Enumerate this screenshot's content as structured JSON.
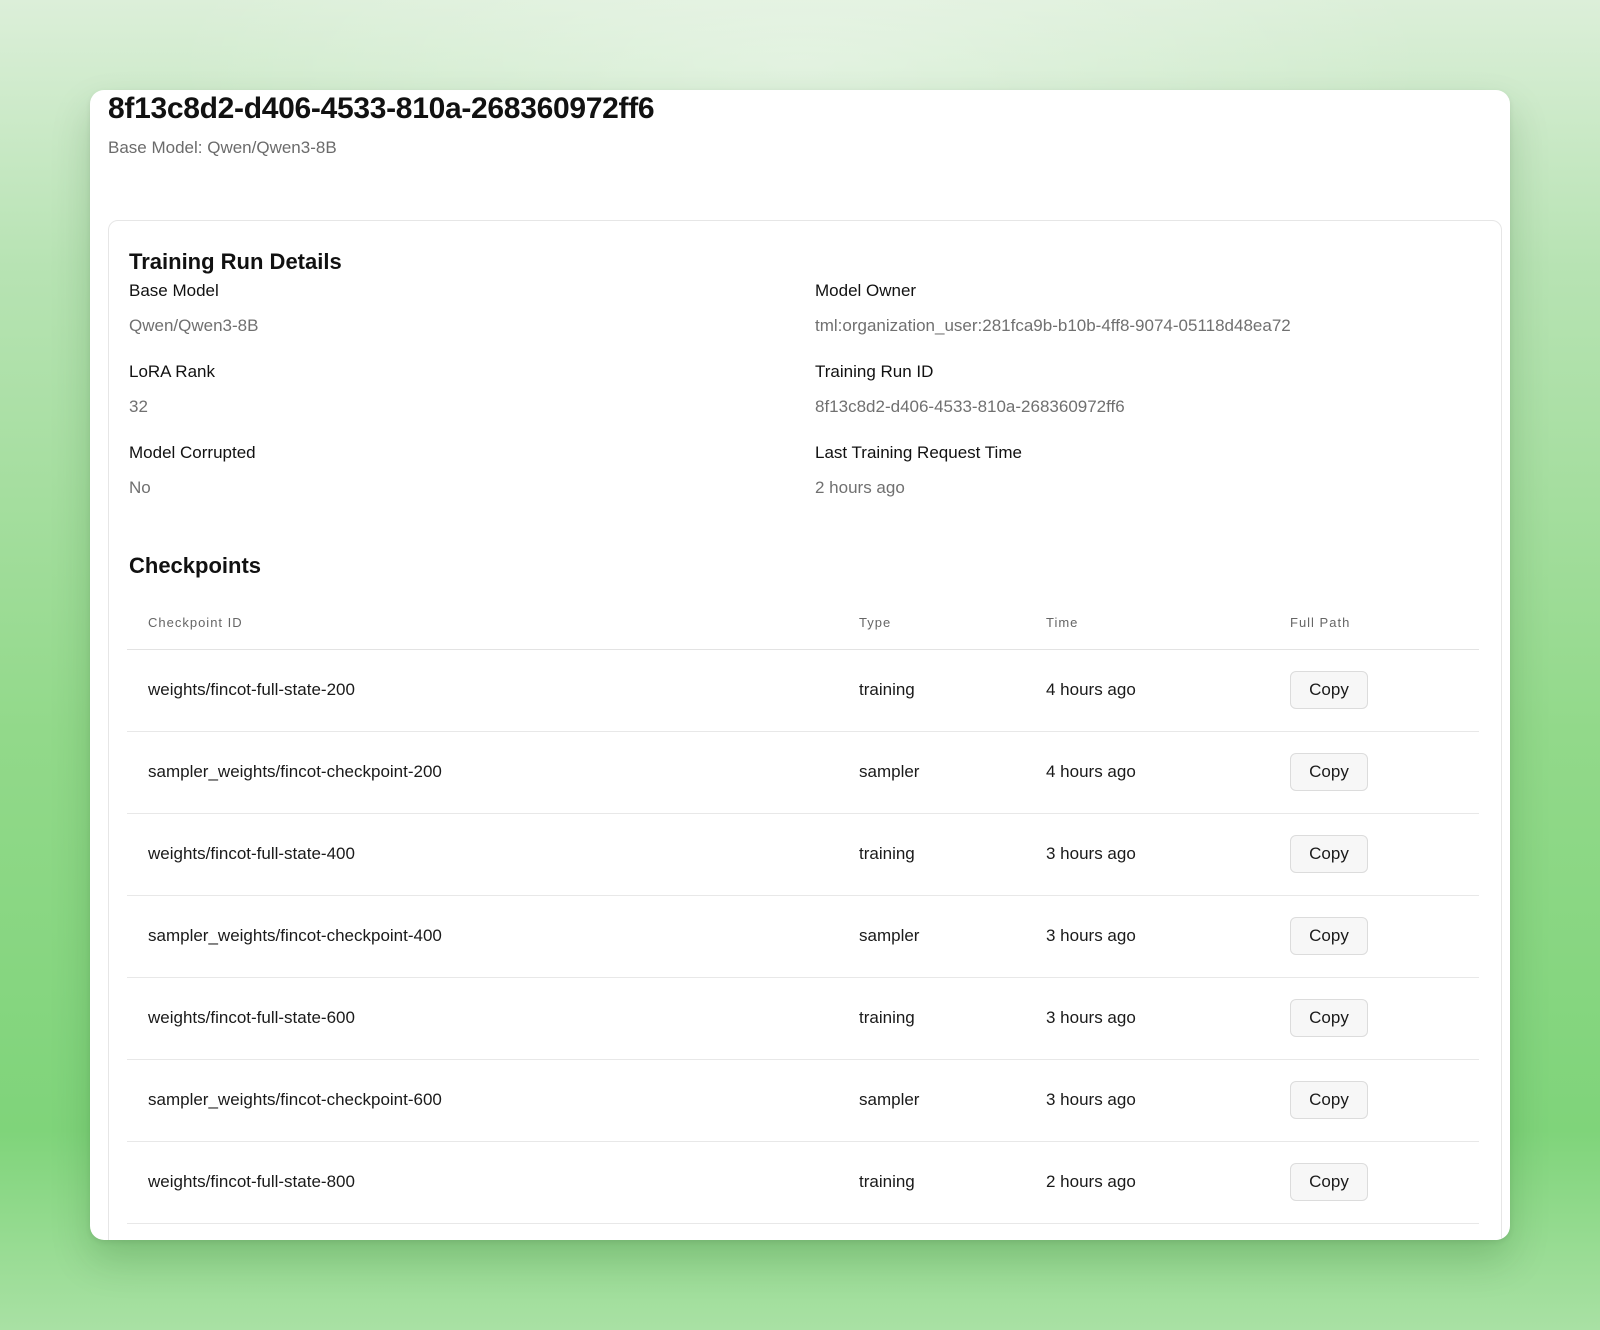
{
  "header": {
    "title": "8f13c8d2-d406-4533-810a-268360972ff6",
    "subtitle": "Base Model: Qwen/Qwen3-8B"
  },
  "details": {
    "section_title": "Training Run Details",
    "base_model": {
      "label": "Base Model",
      "value": "Qwen/Qwen3-8B"
    },
    "model_owner": {
      "label": "Model Owner",
      "value": "tml:organization_user:281fca9b-b10b-4ff8-9074-05118d48ea72"
    },
    "lora_rank": {
      "label": "LoRA Rank",
      "value": "32"
    },
    "training_run_id": {
      "label": "Training Run ID",
      "value": "8f13c8d2-d406-4533-810a-268360972ff6"
    },
    "model_corrupted": {
      "label": "Model Corrupted",
      "value": "No"
    },
    "last_request_time": {
      "label": "Last Training Request Time",
      "value": "2 hours ago"
    }
  },
  "checkpoints": {
    "section_title": "Checkpoints",
    "columns": [
      "Checkpoint ID",
      "Type",
      "Time",
      "Full Path"
    ],
    "rows": [
      {
        "id": "weights/fincot-full-state-200",
        "type": "training",
        "time": "4 hours ago",
        "action": "Copy"
      },
      {
        "id": "sampler_weights/fincot-checkpoint-200",
        "type": "sampler",
        "time": "4 hours ago",
        "action": "Copy"
      },
      {
        "id": "weights/fincot-full-state-400",
        "type": "training",
        "time": "3 hours ago",
        "action": "Copy"
      },
      {
        "id": "sampler_weights/fincot-checkpoint-400",
        "type": "sampler",
        "time": "3 hours ago",
        "action": "Copy"
      },
      {
        "id": "weights/fincot-full-state-600",
        "type": "training",
        "time": "3 hours ago",
        "action": "Copy"
      },
      {
        "id": "sampler_weights/fincot-checkpoint-600",
        "type": "sampler",
        "time": "3 hours ago",
        "action": "Copy"
      },
      {
        "id": "weights/fincot-full-state-800",
        "type": "training",
        "time": "2 hours ago",
        "action": "Copy"
      }
    ]
  }
}
